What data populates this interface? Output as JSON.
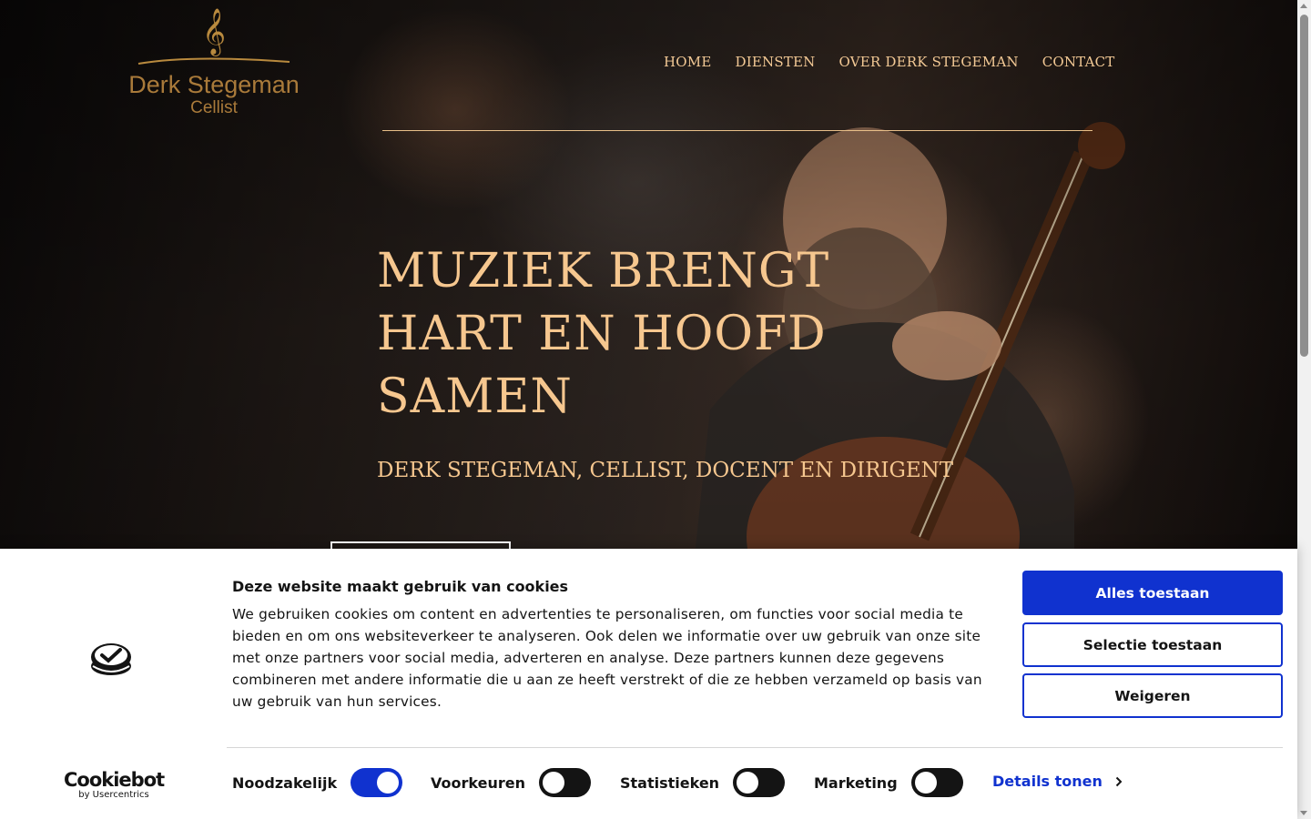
{
  "logo": {
    "clef": "𝄞",
    "name": "Derk Stegeman",
    "subtitle": "Cellist"
  },
  "nav": {
    "items": [
      {
        "label": "HOME"
      },
      {
        "label": "DIENSTEN"
      },
      {
        "label": "OVER DERK STEGEMAN"
      },
      {
        "label": "CONTACT"
      }
    ]
  },
  "hero": {
    "headline": "MUZIEK BRENGT HART EN HOOFD SAMEN",
    "subheadline": "DERK STEGEMAN, CELLIST, DOCENT EN DIRIGENT"
  },
  "cookie": {
    "title": "Deze website maakt gebruik van cookies",
    "text": "We gebruiken cookies om content en advertenties te personaliseren, om functies voor social media te bieden en om ons websiteverkeer te analyseren. Ook delen we informatie over uw gebruik van onze site met onze partners voor social media, adverteren en analyse. Deze partners kunnen deze gegevens combineren met andere informatie die u aan ze heeft verstrekt of die ze hebben verzameld op basis van uw gebruik van hun services.",
    "buttons": {
      "allow_all": "Alles toestaan",
      "allow_selection": "Selectie toestaan",
      "deny": "Weigeren"
    },
    "brand": {
      "name": "Cookiebot",
      "by": "by Usercentrics"
    },
    "toggles": [
      {
        "label": "Noodzakelijk",
        "checked": true
      },
      {
        "label": "Voorkeuren",
        "checked": false
      },
      {
        "label": "Statistieken",
        "checked": false
      },
      {
        "label": "Marketing",
        "checked": false
      }
    ],
    "details_link": "Details tonen"
  },
  "colors": {
    "accent_gold": "#f6c78f",
    "cookie_blue": "#1032cf"
  }
}
